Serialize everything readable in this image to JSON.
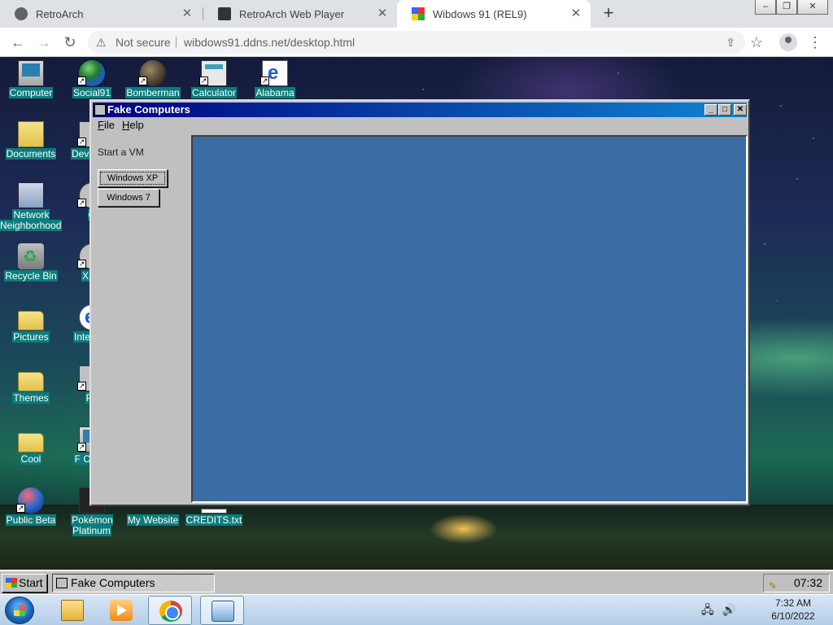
{
  "browser": {
    "tabs": [
      {
        "label": "RetroArch",
        "active": false,
        "icon": "chrome-globe-icon"
      },
      {
        "label": "RetroArch Web Player",
        "active": false,
        "icon": "retroarch-icon"
      },
      {
        "label": "Wibdows 91 (REL9)",
        "active": true,
        "icon": "windows-flag-icon"
      }
    ],
    "security_label": "Not secure",
    "url": "wibdows91.ddns.net/desktop.html"
  },
  "desktop": {
    "icons": [
      {
        "label": "Computer"
      },
      {
        "label": "Social91"
      },
      {
        "label": "Bomberman"
      },
      {
        "label": "Calculator"
      },
      {
        "label": "Alabama"
      },
      {
        "label": "Documents"
      },
      {
        "label": "Devel Ins"
      },
      {
        "label": "Network Neighborhood"
      },
      {
        "label": "C"
      },
      {
        "label": "Recycle Bin"
      },
      {
        "label": "XSS"
      },
      {
        "label": "Pictures"
      },
      {
        "label": "Inte Exp"
      },
      {
        "label": "Themes"
      },
      {
        "label": "Pa"
      },
      {
        "label": "Cool"
      },
      {
        "label": "F Comp"
      },
      {
        "label": "Public Beta"
      },
      {
        "label": "Pokémon Platinum"
      },
      {
        "label": "My Website"
      },
      {
        "label": "CREDITS.txt"
      }
    ]
  },
  "window": {
    "title": "Fake Computers",
    "menu": [
      "File",
      "Help"
    ],
    "sidebar_heading": "Start a VM",
    "vm_buttons": [
      "Windows XP",
      "Windows 7"
    ]
  },
  "w9_taskbar": {
    "start_label": "Start",
    "task_label": "Fake Computers",
    "clock": "07:32"
  },
  "host_taskbar": {
    "time": "7:32 AM",
    "date": "6/10/2022"
  },
  "colors": {
    "titlebar_start": "#000080",
    "titlebar_end": "#1084d0",
    "vm_screen": "#3b6ca3",
    "icon_label_bg": "#0b7c7c"
  }
}
